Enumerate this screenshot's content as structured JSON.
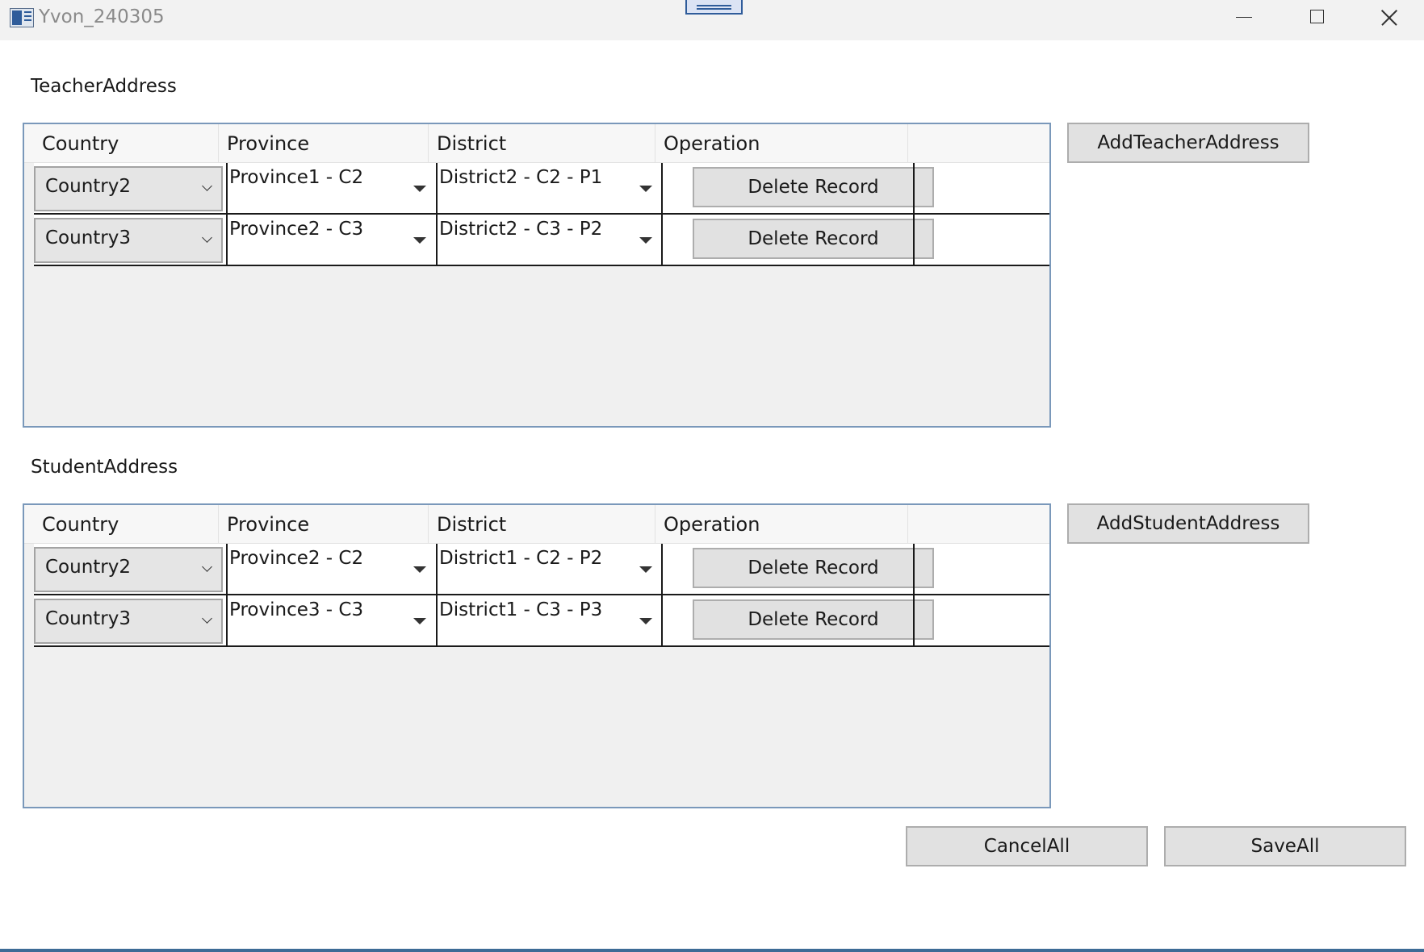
{
  "window": {
    "title": "Yvon_240305"
  },
  "columns": [
    "Country",
    "Province",
    "District",
    "Operation"
  ],
  "teacher": {
    "label": "TeacherAddress",
    "add_button": "AddTeacherAddress",
    "rows": [
      {
        "country": "Country2",
        "province": "Province1 - C2",
        "district": "District2 - C2 - P1",
        "action": "Delete Record"
      },
      {
        "country": "Country3",
        "province": "Province2 - C3",
        "district": "District2 - C3 - P2",
        "action": "Delete Record"
      }
    ]
  },
  "student": {
    "label": "StudentAddress",
    "add_button": "AddStudentAddress",
    "rows": [
      {
        "country": "Country2",
        "province": "Province2 - C2",
        "district": "District1 - C2 - P2",
        "action": "Delete Record"
      },
      {
        "country": "Country3",
        "province": "Province3 - C3",
        "district": "District1 - C3 - P3",
        "action": "Delete Record"
      }
    ]
  },
  "footer": {
    "cancel_label": "CancelAll",
    "save_label": "SaveAll"
  },
  "icons": {
    "app": "window-app-icon",
    "minimize": "minimize-icon",
    "maximize": "maximize-icon",
    "close": "close-icon",
    "dropdown": "chevron-down-icon",
    "select_arrow": "caret-down-icon"
  },
  "colors": {
    "grid_border": "#7a98ba",
    "button_face": "#e1e1e1",
    "titlebar": "#f2f2f2",
    "accent": "#2f5c9a"
  }
}
